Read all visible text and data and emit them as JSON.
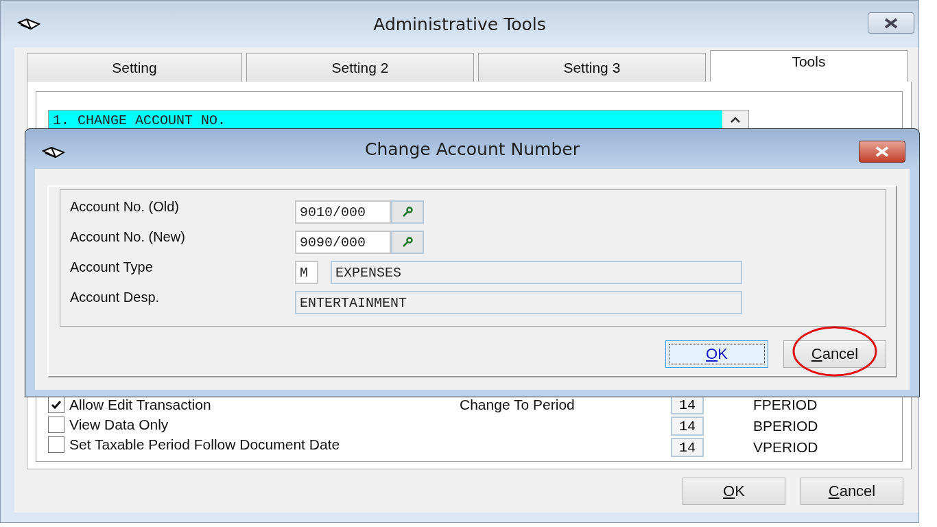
{
  "window": {
    "title": "Administrative Tools"
  },
  "tabs": [
    {
      "label": "Setting",
      "selected": false
    },
    {
      "label": "Setting 2",
      "selected": false
    },
    {
      "label": "Setting 3",
      "selected": false
    },
    {
      "label": "Tools",
      "selected": true
    }
  ],
  "tools_list": {
    "items": [
      {
        "label": "1. CHANGE ACCOUNT NO.",
        "selected": true
      }
    ]
  },
  "options": [
    {
      "label": "Allow Edit Transaction",
      "checked": true
    },
    {
      "label": "View Data Only",
      "checked": false
    },
    {
      "label": "Set Taxable Period Follow Document Date",
      "checked": false
    }
  ],
  "period": {
    "label": "Change To Period",
    "fields": [
      {
        "value": "14",
        "name": "FPERIOD"
      },
      {
        "value": "14",
        "name": "BPERIOD"
      },
      {
        "value": "14",
        "name": "VPERIOD"
      }
    ]
  },
  "buttons": [
    {
      "label": "OK"
    },
    {
      "label": "Cancel"
    }
  ],
  "dialog": {
    "title": "Change Account Number",
    "fields": [
      {
        "label": "Account No. (Old)",
        "kind": "lookup",
        "value": "9010/000"
      },
      {
        "label": "Account No. (New)",
        "kind": "lookup",
        "value": "9090/000"
      },
      {
        "label": "Account Type",
        "kind": "coded",
        "code": "M",
        "value": "EXPENSES"
      },
      {
        "label": "Account Desp.",
        "kind": "text",
        "value": "ENTERTAINMENT"
      }
    ],
    "buttons": [
      {
        "label": "OK",
        "focused": true,
        "circled": false
      },
      {
        "label": "Cancel",
        "focused": false,
        "circled": true
      }
    ]
  }
}
